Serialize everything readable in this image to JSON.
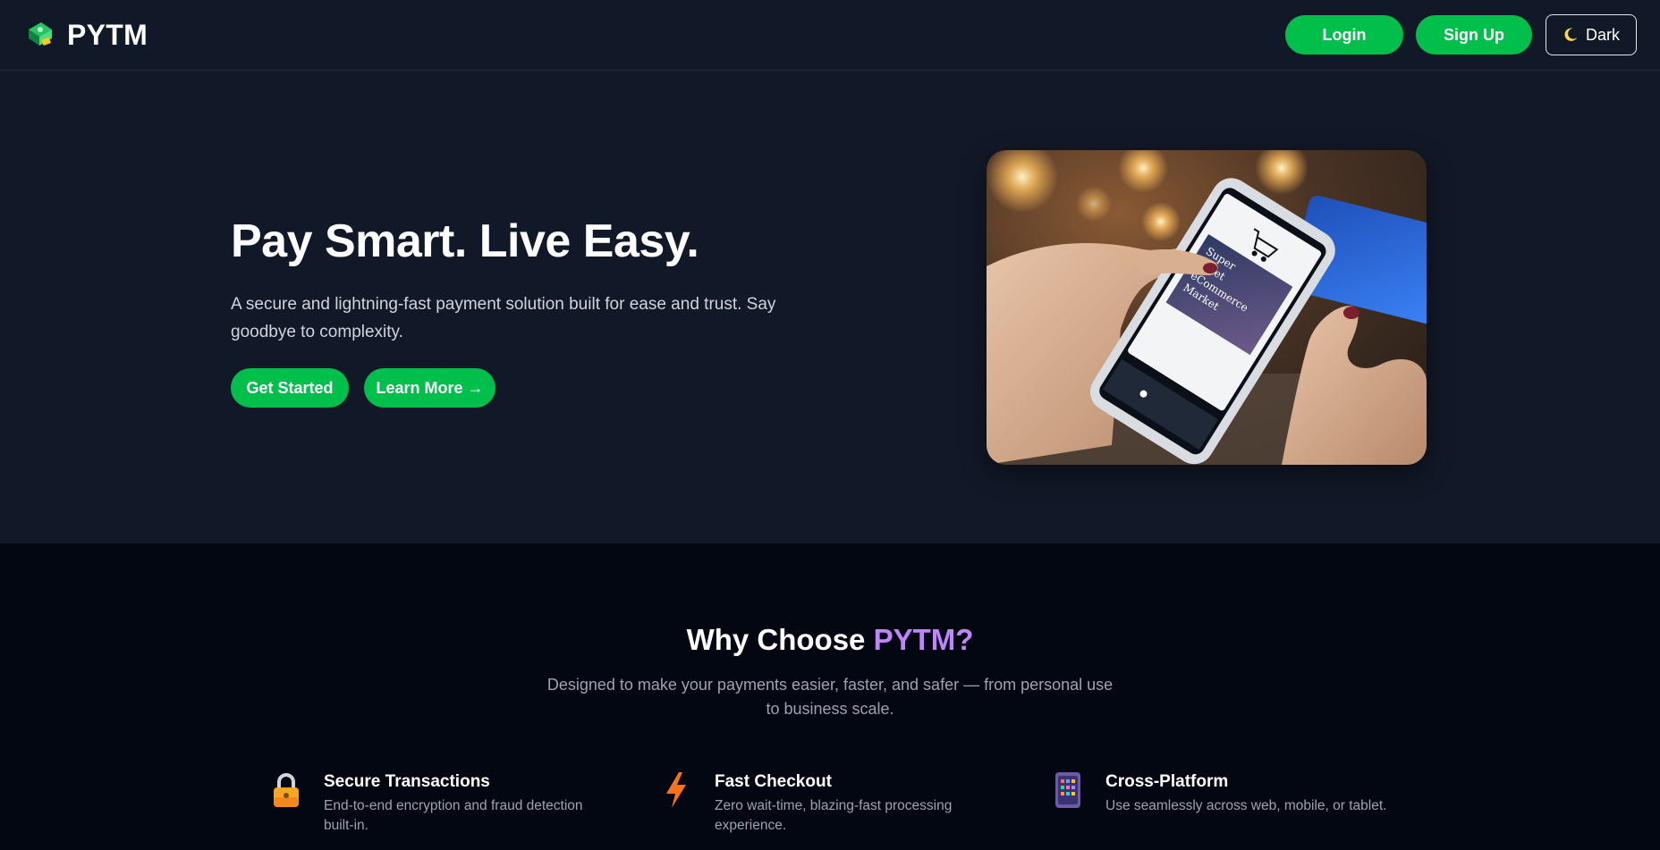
{
  "header": {
    "brand": "PYTM",
    "login_label": "Login",
    "signup_label": "Sign Up",
    "theme_label": "Dark",
    "theme_icon": "moon-icon"
  },
  "hero": {
    "title": "Pay Smart. Live Easy.",
    "description": "A secure and lightning-fast payment solution built for ease and trust. Say goodbye to complexity.",
    "primary_cta": "Get Started",
    "secondary_cta": "Learn More →",
    "image_text": [
      "Super",
      "ernet",
      "eCommerce",
      "Market"
    ]
  },
  "features": {
    "title_prefix": "Why Choose ",
    "title_accent": "PYTM?",
    "subtitle": "Designed to make your payments easier, faster, and safer — from personal use to business scale.",
    "items": [
      {
        "icon": "lock-icon",
        "title": "Secure Transactions",
        "text": "End-to-end encryption and fraud detection built-in."
      },
      {
        "icon": "lightning-icon",
        "title": "Fast Checkout",
        "text": "Zero wait-time, blazing-fast processing experience."
      },
      {
        "icon": "devices-icon",
        "title": "Cross-Platform",
        "text": "Use seamlessly across web, mobile, or tablet."
      }
    ]
  },
  "colors": {
    "primary_green": "#00c04b",
    "accent_purple": "#c084fc",
    "header_bg": "#111827",
    "features_bg": "#030712"
  }
}
